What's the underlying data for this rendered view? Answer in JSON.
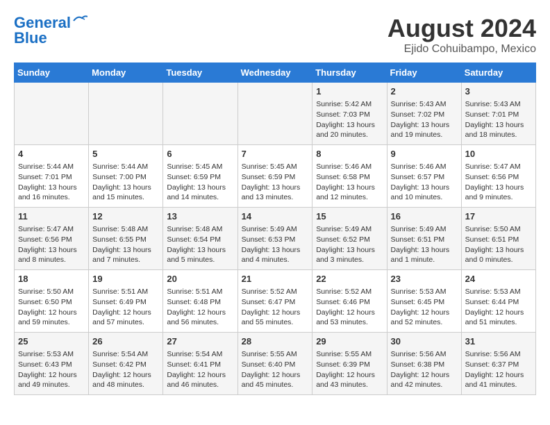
{
  "header": {
    "logo_line1": "General",
    "logo_line2": "Blue",
    "title": "August 2024",
    "subtitle": "Ejido Cohuibampo, Mexico"
  },
  "days_of_week": [
    "Sunday",
    "Monday",
    "Tuesday",
    "Wednesday",
    "Thursday",
    "Friday",
    "Saturday"
  ],
  "weeks": [
    [
      {
        "day": "",
        "info": ""
      },
      {
        "day": "",
        "info": ""
      },
      {
        "day": "",
        "info": ""
      },
      {
        "day": "",
        "info": ""
      },
      {
        "day": "1",
        "info": "Sunrise: 5:42 AM\nSunset: 7:03 PM\nDaylight: 13 hours\nand 20 minutes."
      },
      {
        "day": "2",
        "info": "Sunrise: 5:43 AM\nSunset: 7:02 PM\nDaylight: 13 hours\nand 19 minutes."
      },
      {
        "day": "3",
        "info": "Sunrise: 5:43 AM\nSunset: 7:01 PM\nDaylight: 13 hours\nand 18 minutes."
      }
    ],
    [
      {
        "day": "4",
        "info": "Sunrise: 5:44 AM\nSunset: 7:01 PM\nDaylight: 13 hours\nand 16 minutes."
      },
      {
        "day": "5",
        "info": "Sunrise: 5:44 AM\nSunset: 7:00 PM\nDaylight: 13 hours\nand 15 minutes."
      },
      {
        "day": "6",
        "info": "Sunrise: 5:45 AM\nSunset: 6:59 PM\nDaylight: 13 hours\nand 14 minutes."
      },
      {
        "day": "7",
        "info": "Sunrise: 5:45 AM\nSunset: 6:59 PM\nDaylight: 13 hours\nand 13 minutes."
      },
      {
        "day": "8",
        "info": "Sunrise: 5:46 AM\nSunset: 6:58 PM\nDaylight: 13 hours\nand 12 minutes."
      },
      {
        "day": "9",
        "info": "Sunrise: 5:46 AM\nSunset: 6:57 PM\nDaylight: 13 hours\nand 10 minutes."
      },
      {
        "day": "10",
        "info": "Sunrise: 5:47 AM\nSunset: 6:56 PM\nDaylight: 13 hours\nand 9 minutes."
      }
    ],
    [
      {
        "day": "11",
        "info": "Sunrise: 5:47 AM\nSunset: 6:56 PM\nDaylight: 13 hours\nand 8 minutes."
      },
      {
        "day": "12",
        "info": "Sunrise: 5:48 AM\nSunset: 6:55 PM\nDaylight: 13 hours\nand 7 minutes."
      },
      {
        "day": "13",
        "info": "Sunrise: 5:48 AM\nSunset: 6:54 PM\nDaylight: 13 hours\nand 5 minutes."
      },
      {
        "day": "14",
        "info": "Sunrise: 5:49 AM\nSunset: 6:53 PM\nDaylight: 13 hours\nand 4 minutes."
      },
      {
        "day": "15",
        "info": "Sunrise: 5:49 AM\nSunset: 6:52 PM\nDaylight: 13 hours\nand 3 minutes."
      },
      {
        "day": "16",
        "info": "Sunrise: 5:49 AM\nSunset: 6:51 PM\nDaylight: 13 hours\nand 1 minute."
      },
      {
        "day": "17",
        "info": "Sunrise: 5:50 AM\nSunset: 6:51 PM\nDaylight: 13 hours\nand 0 minutes."
      }
    ],
    [
      {
        "day": "18",
        "info": "Sunrise: 5:50 AM\nSunset: 6:50 PM\nDaylight: 12 hours\nand 59 minutes."
      },
      {
        "day": "19",
        "info": "Sunrise: 5:51 AM\nSunset: 6:49 PM\nDaylight: 12 hours\nand 57 minutes."
      },
      {
        "day": "20",
        "info": "Sunrise: 5:51 AM\nSunset: 6:48 PM\nDaylight: 12 hours\nand 56 minutes."
      },
      {
        "day": "21",
        "info": "Sunrise: 5:52 AM\nSunset: 6:47 PM\nDaylight: 12 hours\nand 55 minutes."
      },
      {
        "day": "22",
        "info": "Sunrise: 5:52 AM\nSunset: 6:46 PM\nDaylight: 12 hours\nand 53 minutes."
      },
      {
        "day": "23",
        "info": "Sunrise: 5:53 AM\nSunset: 6:45 PM\nDaylight: 12 hours\nand 52 minutes."
      },
      {
        "day": "24",
        "info": "Sunrise: 5:53 AM\nSunset: 6:44 PM\nDaylight: 12 hours\nand 51 minutes."
      }
    ],
    [
      {
        "day": "25",
        "info": "Sunrise: 5:53 AM\nSunset: 6:43 PM\nDaylight: 12 hours\nand 49 minutes."
      },
      {
        "day": "26",
        "info": "Sunrise: 5:54 AM\nSunset: 6:42 PM\nDaylight: 12 hours\nand 48 minutes."
      },
      {
        "day": "27",
        "info": "Sunrise: 5:54 AM\nSunset: 6:41 PM\nDaylight: 12 hours\nand 46 minutes."
      },
      {
        "day": "28",
        "info": "Sunrise: 5:55 AM\nSunset: 6:40 PM\nDaylight: 12 hours\nand 45 minutes."
      },
      {
        "day": "29",
        "info": "Sunrise: 5:55 AM\nSunset: 6:39 PM\nDaylight: 12 hours\nand 43 minutes."
      },
      {
        "day": "30",
        "info": "Sunrise: 5:56 AM\nSunset: 6:38 PM\nDaylight: 12 hours\nand 42 minutes."
      },
      {
        "day": "31",
        "info": "Sunrise: 5:56 AM\nSunset: 6:37 PM\nDaylight: 12 hours\nand 41 minutes."
      }
    ]
  ]
}
